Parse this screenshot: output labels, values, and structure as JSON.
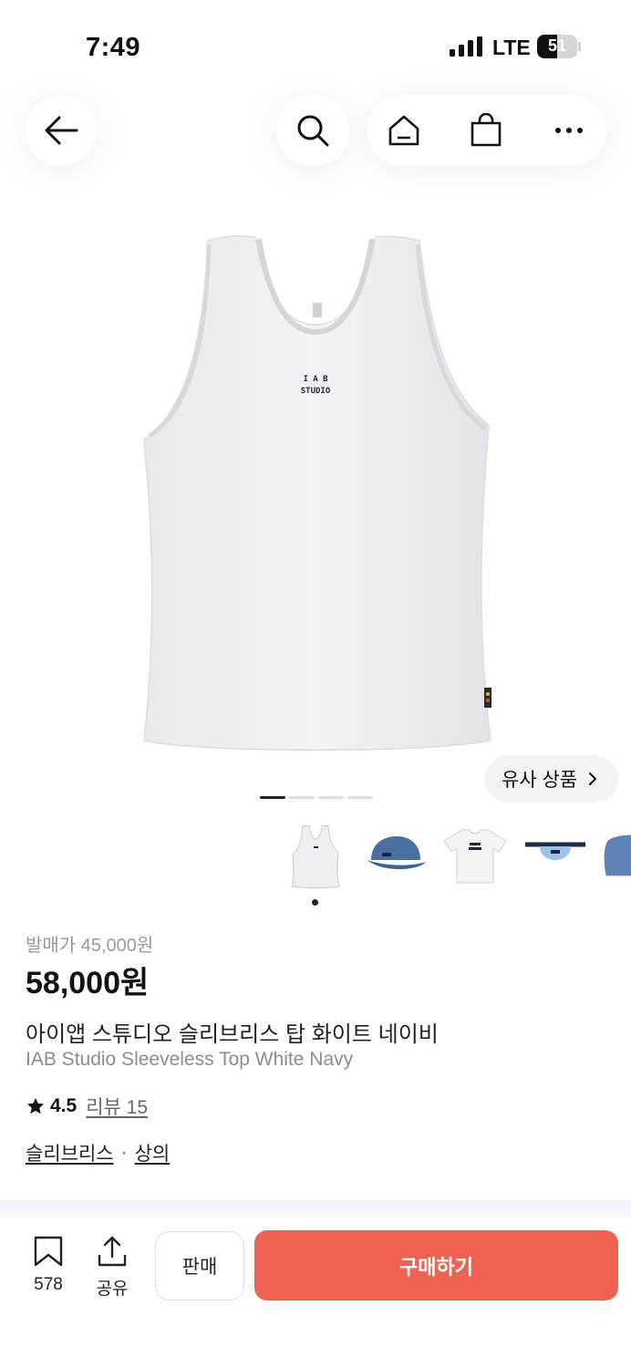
{
  "status_bar": {
    "time": "7:49",
    "network": "LTE",
    "battery_level": "51"
  },
  "nav": {
    "back_icon": "arrow-left-icon",
    "search_icon": "search-icon",
    "home_icon": "home-icon",
    "bag_icon": "shopping-bag-icon",
    "more_icon": "more-icon"
  },
  "gallery": {
    "logo_line1": "I A B",
    "logo_line2": "STUDIO",
    "similar_button_label": "유사 상품",
    "page_count": 4,
    "active_page": 1
  },
  "thumbnails": [
    {
      "name": "tank-top-white",
      "selected": true
    },
    {
      "name": "denim-cap",
      "selected": false
    },
    {
      "name": "white-tshirt",
      "selected": false
    },
    {
      "name": "belt-bag",
      "selected": false
    },
    {
      "name": "denim-item",
      "selected": false
    }
  ],
  "product": {
    "release_price": "발매가 45,000원",
    "price": "58,000원",
    "name_ko": "아이앱 스튜디오 슬리브리스 탑 화이트 네이비",
    "name_en": "IAB Studio Sleeveless Top White Navy",
    "rating": "4.5",
    "review_label": "리뷰 15",
    "category_1": "슬리브리스",
    "category_sep": "·",
    "category_2": "상의"
  },
  "bottom_bar": {
    "save_count": "578",
    "share_label": "공유",
    "sell_label": "판매",
    "buy_label": "구매하기"
  },
  "colors": {
    "buy_button": "#ef6253",
    "text_primary": "#111111",
    "text_muted": "#9a9a9a"
  }
}
